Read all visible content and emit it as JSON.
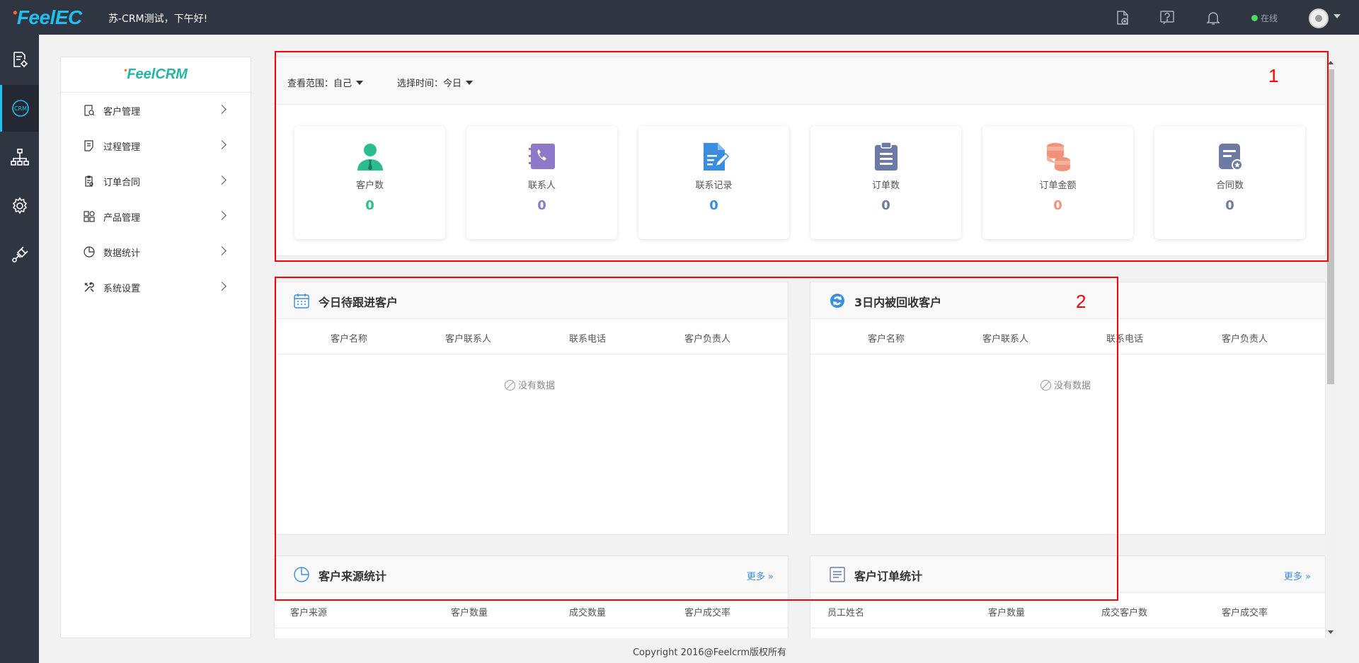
{
  "topbar": {
    "logo": "FeelEC",
    "greeting": "苏-CRM测试，下午好!",
    "status": "在线",
    "icons": [
      "document-add-icon",
      "help-icon",
      "bell-icon",
      "avatar",
      "caret-down-icon"
    ]
  },
  "rail": {
    "items": [
      "document-settings-icon",
      "crm-icon",
      "org-chart-icon",
      "gear-icon",
      "plugin-icon"
    ],
    "active": "crm-icon"
  },
  "sidebar": {
    "logo": "FeelCRM",
    "items": [
      {
        "label": "客户管理",
        "icon": "customer-search-icon"
      },
      {
        "label": "过程管理",
        "icon": "process-icon"
      },
      {
        "label": "订单合同",
        "icon": "order-contract-icon"
      },
      {
        "label": "产品管理",
        "icon": "product-grid-icon"
      },
      {
        "label": "数据统计",
        "icon": "pie-chart-icon"
      },
      {
        "label": "系统设置",
        "icon": "tools-icon"
      }
    ]
  },
  "filters": {
    "scope_label": "查看范围：",
    "scope_value": "自己",
    "time_label": "选择时间：",
    "time_value": "今日"
  },
  "stats": [
    {
      "label": "客户数",
      "value": "0",
      "color": "#2bbd8e",
      "icon": "user-icon"
    },
    {
      "label": "联系人",
      "value": "0",
      "color": "#8e79c9",
      "icon": "contact-book-icon"
    },
    {
      "label": "联系记录",
      "value": "0",
      "color": "#3b8de0",
      "icon": "record-edit-icon"
    },
    {
      "label": "订单数",
      "value": "0",
      "color": "#6d7aa5",
      "icon": "clipboard-icon"
    },
    {
      "label": "订单金额",
      "value": "0",
      "color": "#f29279",
      "icon": "coins-icon"
    },
    {
      "label": "合同数",
      "value": "0",
      "color": "#6d7aa5",
      "icon": "contract-icon"
    }
  ],
  "panels": {
    "followup": {
      "title": "今日待跟进客户",
      "columns": [
        "客户名称",
        "客户联系人",
        "联系电话",
        "客户负责人"
      ],
      "empty": "没有数据"
    },
    "recycled": {
      "title": "3日内被回收客户",
      "columns": [
        "客户名称",
        "客户联系人",
        "联系电话",
        "客户负责人"
      ],
      "empty": "没有数据"
    },
    "source_stats": {
      "title": "客户来源统计",
      "more": "更多",
      "columns": [
        "客户来源",
        "客户数量",
        "成交数量",
        "客户成交率"
      ]
    },
    "order_stats": {
      "title": "客户订单统计",
      "more": "更多",
      "columns": [
        "员工姓名",
        "客户数量",
        "成交客户数",
        "客户成交率"
      ]
    }
  },
  "annotations": {
    "box1": "1",
    "box2": "2"
  },
  "footer": "Copyright 2016@Feelcrm版权所有",
  "colors": {
    "topbar": "#2f3541",
    "accent": "#1ec0f0",
    "link": "#3b8de0",
    "annotation": "#ff0000"
  }
}
